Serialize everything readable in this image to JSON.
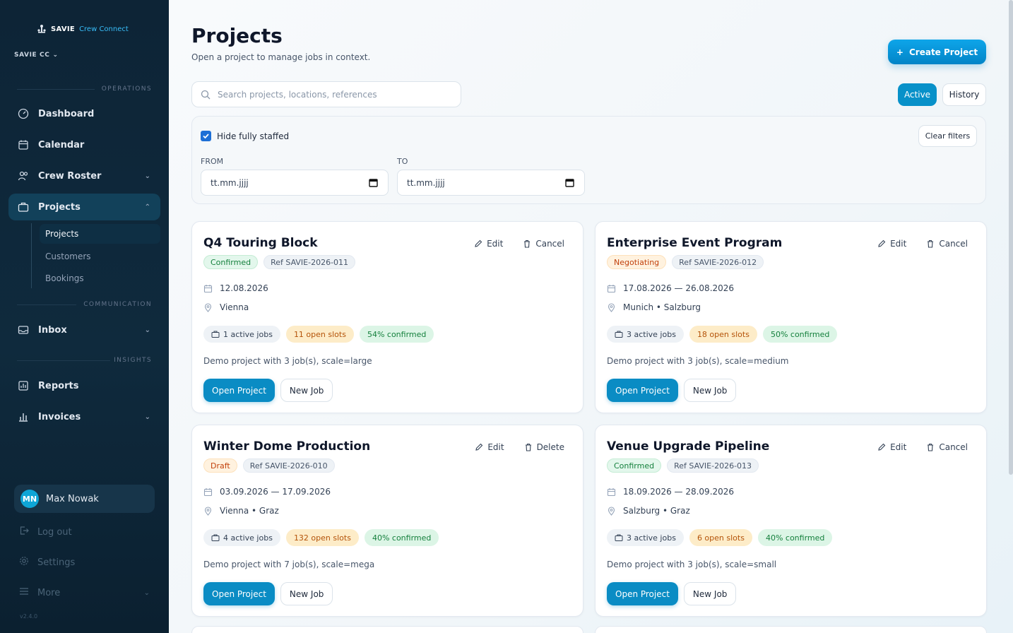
{
  "brand": {
    "name": "SAVIE",
    "sub": "Crew Connect"
  },
  "org": {
    "name": "SAVIE CC"
  },
  "sections": {
    "operations": "OPERATIONS",
    "communication": "COMMUNICATION",
    "insights": "INSIGHTS"
  },
  "nav": {
    "dashboard": "Dashboard",
    "calendar": "Calendar",
    "crew_roster": "Crew Roster",
    "projects": "Projects",
    "inbox": "Inbox",
    "reports": "Reports",
    "invoices": "Invoices"
  },
  "subnav": {
    "projects": "Projects",
    "customers": "Customers",
    "bookings": "Bookings"
  },
  "user": {
    "initials": "MN",
    "name": "Max Nowak"
  },
  "footer": {
    "logout": "Log out",
    "settings": "Settings",
    "more": "More",
    "version": "v2.4.0"
  },
  "page": {
    "title": "Projects",
    "subtitle": "Open a project to manage jobs in context.",
    "create_label": "Create Project"
  },
  "search": {
    "placeholder": "Search projects, locations, references"
  },
  "toggle": {
    "active": "Active",
    "history": "History"
  },
  "filters": {
    "hide_staffed_label": "Hide fully staffed",
    "hide_staffed_checked": true,
    "clear_label": "Clear filters",
    "from_label": "FROM",
    "to_label": "TO",
    "from_value": "tt.mm.jjjj",
    "to_value": "tt.mm.jjjj"
  },
  "cards": [
    {
      "title": "Q4 Touring Block",
      "status": "Confirmed",
      "ref": "Ref SAVIE-2026-011",
      "dates": "12.08.2026",
      "location": "Vienna",
      "jobs": "1 active jobs",
      "open": "11 open slots",
      "confirmed": "54% confirmed",
      "desc": "Demo project with 3 job(s), scale=large",
      "edit": "Edit",
      "secondary": "Cancel",
      "open_btn": "Open Project",
      "new_btn": "New Job"
    },
    {
      "title": "Enterprise Event Program",
      "status": "Negotiating",
      "ref": "Ref SAVIE-2026-012",
      "dates": "17.08.2026 — 26.08.2026",
      "location": "Munich • Salzburg",
      "jobs": "3 active jobs",
      "open": "18 open slots",
      "confirmed": "50% confirmed",
      "desc": "Demo project with 3 job(s), scale=medium",
      "edit": "Edit",
      "secondary": "Cancel",
      "open_btn": "Open Project",
      "new_btn": "New Job"
    },
    {
      "title": "Winter Dome Production",
      "status": "Draft",
      "ref": "Ref SAVIE-2026-010",
      "dates": "03.09.2026 — 17.09.2026",
      "location": "Vienna • Graz",
      "jobs": "4 active jobs",
      "open": "132 open slots",
      "confirmed": "40% confirmed",
      "desc": "Demo project with 7 job(s), scale=mega",
      "edit": "Edit",
      "secondary": "Delete",
      "open_btn": "Open Project",
      "new_btn": "New Job"
    },
    {
      "title": "Venue Upgrade Pipeline",
      "status": "Confirmed",
      "ref": "Ref SAVIE-2026-013",
      "dates": "18.09.2026 — 28.09.2026",
      "location": "Salzburg • Graz",
      "jobs": "3 active jobs",
      "open": "6 open slots",
      "confirmed": "40% confirmed",
      "desc": "Demo project with 3 job(s), scale=small",
      "edit": "Edit",
      "secondary": "Cancel",
      "open_btn": "Open Project",
      "new_btn": "New Job"
    }
  ],
  "colors": {
    "accent": "#0891c9",
    "sidebar": "#0f2a3d",
    "confirmed": "#15803d",
    "warning": "#c2410c"
  }
}
